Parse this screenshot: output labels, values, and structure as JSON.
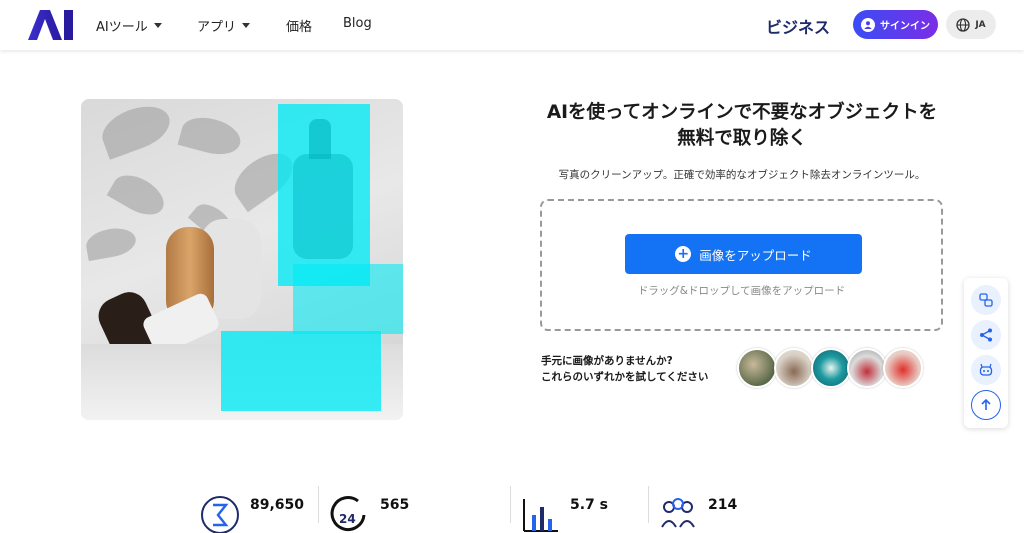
{
  "header": {
    "logo_alt": "AI",
    "nav": [
      {
        "label": "AIツール",
        "has_caret": true
      },
      {
        "label": "アプリ",
        "has_caret": true
      },
      {
        "label": "価格",
        "has_caret": false
      },
      {
        "label": "Blog",
        "has_caret": false
      }
    ],
    "business_label": "ビジネス",
    "signin_label": "サインイン",
    "lang_label": "JA"
  },
  "hero": {
    "title_line1": "AIを使ってオンラインで不要なオブジェクトを",
    "title_line2": "無料で取り除く",
    "subtitle": "写真のクリーンアップ。正確で効率的なオブジェクト除去オンラインツール。",
    "upload_button_label": "画像をアップロード",
    "drop_hint": "ドラッグ&ドロップして画像をアップロード",
    "sample_prompt_line1": "手元に画像がありませんか?",
    "sample_prompt_line2": "これらのいずれかを試してください"
  },
  "stats": [
    {
      "value": "89,650",
      "icon": "sigma-icon"
    },
    {
      "value": "565",
      "icon": "24h-clock-icon"
    },
    {
      "value": "5.7 s",
      "icon": "bar-chart-icon"
    },
    {
      "value": "214",
      "icon": "people-icon"
    }
  ],
  "side_rail": [
    "feedback-icon",
    "share-icon",
    "bot-icon",
    "arrow-up-icon"
  ],
  "colors": {
    "primary": "#1473f5",
    "signin_gradient_start": "#3b4cf5",
    "signin_gradient_end": "#7a2ee6",
    "brand_dark": "#1f2a6b",
    "highlight_cyan": "#00ebf5"
  }
}
